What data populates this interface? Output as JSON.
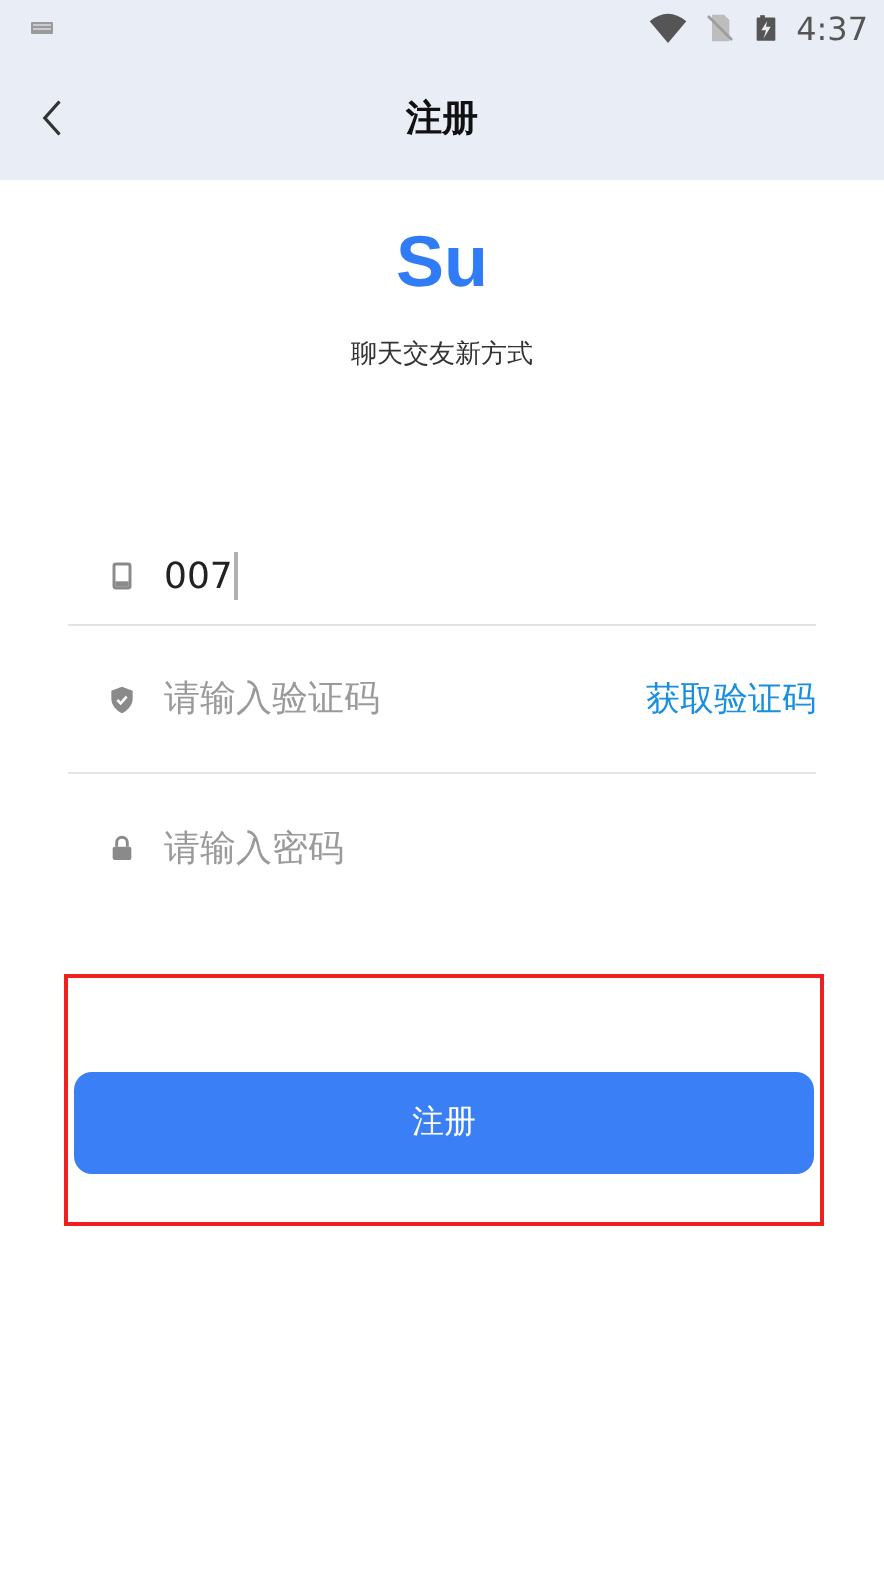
{
  "status_bar": {
    "time": "4:37"
  },
  "app_bar": {
    "title": "注册"
  },
  "logo": "Su",
  "tagline": "聊天交友新方式",
  "fields": [
    {
      "kind": "phone",
      "value": "007",
      "focused": true
    },
    {
      "kind": "code",
      "placeholder": "请输入验证码",
      "action": "获取验证码"
    },
    {
      "kind": "password",
      "placeholder": "请输入密码"
    }
  ],
  "submit": {
    "label": "注册",
    "highlighted": true
  }
}
